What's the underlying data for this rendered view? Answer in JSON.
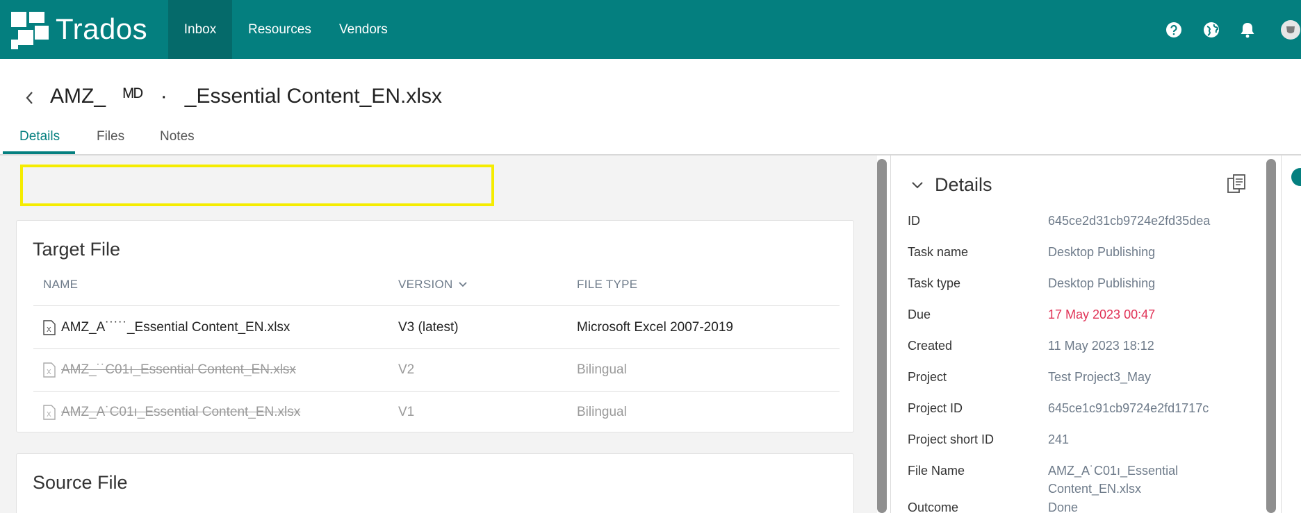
{
  "app": {
    "brand": "Trados"
  },
  "nav": {
    "items": [
      {
        "label": "Inbox",
        "active": true
      },
      {
        "label": "Resources",
        "active": false
      },
      {
        "label": "Vendors",
        "active": false
      }
    ],
    "icons": [
      "help-icon",
      "globe-icon",
      "bell-icon",
      "avatar"
    ]
  },
  "header": {
    "title": "AMZ_   ᴹᴰ   ·   _Essential Content_EN.xlsx"
  },
  "tabs": [
    {
      "label": "Details",
      "active": true
    },
    {
      "label": "Files",
      "active": false
    },
    {
      "label": "Notes",
      "active": false
    }
  ],
  "target_file": {
    "title": "Target File",
    "columns": {
      "name": "NAME",
      "version": "VERSION",
      "file_type": "FILE TYPE"
    },
    "rows": [
      {
        "name": "AMZ_A˙˙˙˙˙_Essential Content_EN.xlsx",
        "version": "V3 (latest)",
        "file_type": "Microsoft Excel 2007-2019"
      },
      {
        "name": "AMZ_˙˙C01ı_Essential Content_EN.xlsx",
        "version": "V2",
        "file_type": "Bilingual"
      },
      {
        "name": "AMZ_A˙C01ı_Essential Content_EN.xlsx",
        "version": "V1",
        "file_type": "Bilingual"
      }
    ]
  },
  "source_file": {
    "title": "Source File"
  },
  "details": {
    "title": "Details",
    "fields": [
      {
        "label": "ID",
        "value": "645ce2d31cb9724e2fd35dea"
      },
      {
        "label": "Task name",
        "value": "Desktop Publishing"
      },
      {
        "label": "Task type",
        "value": "Desktop Publishing"
      },
      {
        "label": "Due",
        "value": "17 May 2023 00:47"
      },
      {
        "label": "Created",
        "value": "11 May 2023 18:12"
      },
      {
        "label": "Project",
        "value": "Test Project3_May"
      },
      {
        "label": "Project ID",
        "value": "645ce1c91cb9724e2fd1717c"
      },
      {
        "label": "Project short ID",
        "value": "241"
      },
      {
        "label": "File Name",
        "value": "AMZ_A˙C01ı_Essential",
        "value_line2": "Content_EN.xlsx"
      },
      {
        "label": "Outcome",
        "value": "Done"
      }
    ]
  },
  "colors": {
    "brand": "#047f7f",
    "nav_active": "#056a6a",
    "due": "#e03155",
    "highlight": "#f5ec00"
  }
}
